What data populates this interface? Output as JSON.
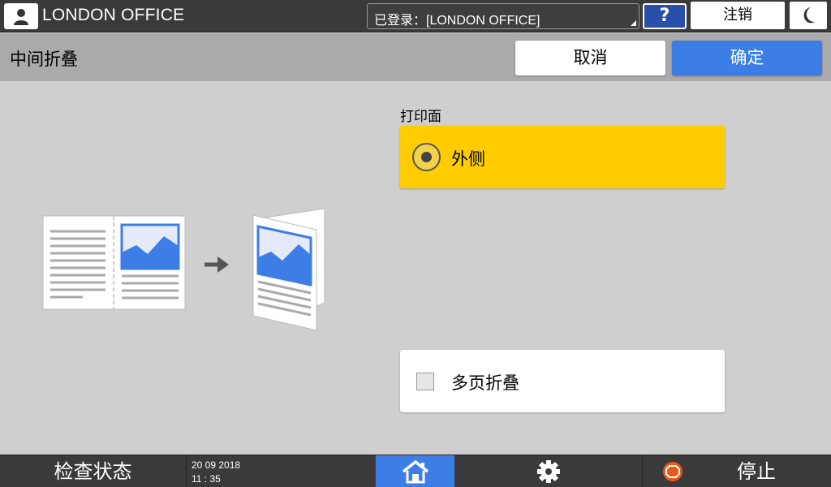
{
  "header": {
    "user_name": "LONDON OFFICE",
    "login_status": "已登录：[LONDON OFFICE]",
    "help_label": "?",
    "logout_label": "注销"
  },
  "titlebar": {
    "title": "中间折叠",
    "cancel_label": "取消",
    "ok_label": "确定"
  },
  "options": {
    "print_side_label": "打印面",
    "outside_label": "外侧",
    "outside_selected": true,
    "multi_page_label": "多页折叠",
    "multi_page_checked": false
  },
  "footer": {
    "status_label": "检查状态",
    "date": "20 09 2018",
    "time": "11 : 35",
    "stop_label": "停止"
  },
  "colors": {
    "accent_blue": "#3d7ee6",
    "selected_yellow": "#ffcc00",
    "stop_orange": "#e8591a"
  }
}
